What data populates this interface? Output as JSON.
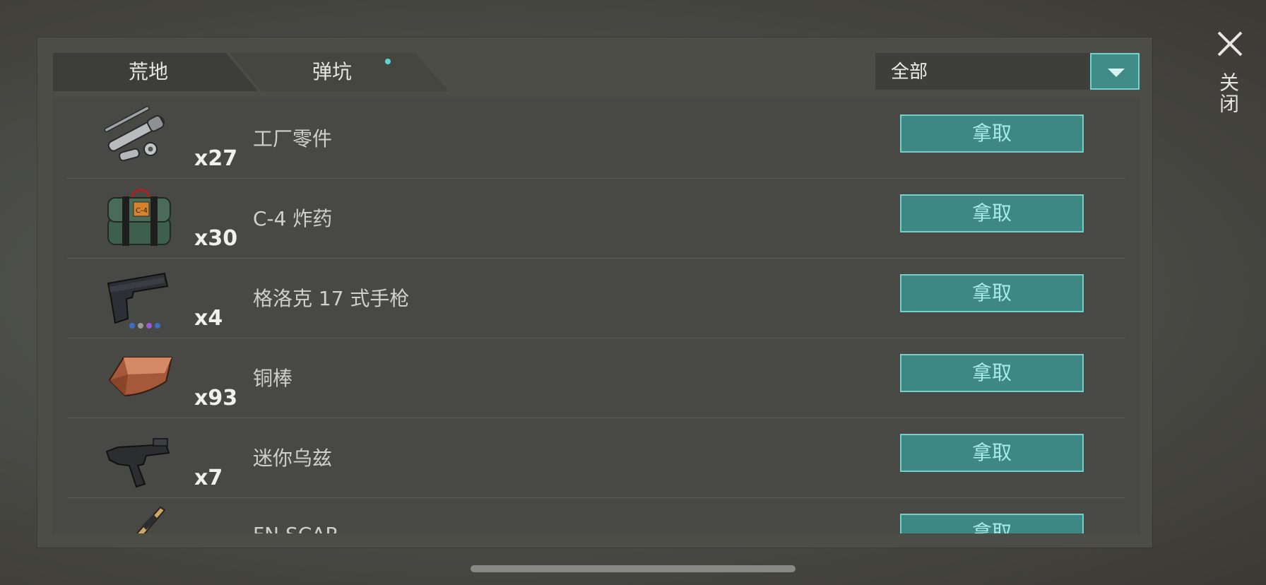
{
  "tabs": [
    {
      "label": "荒地"
    },
    {
      "label": "弹坑"
    }
  ],
  "filter": {
    "value": "全部"
  },
  "close_label": "关闭",
  "take_label": "拿取",
  "items": [
    {
      "name": "工厂零件",
      "qty": "x27",
      "icon": "factory-parts-icon"
    },
    {
      "name": "C-4 炸药",
      "qty": "x30",
      "icon": "c4-explosive-icon"
    },
    {
      "name": "格洛克 17 式手枪",
      "qty": "x4",
      "icon": "glock-pistol-icon"
    },
    {
      "name": "铜棒",
      "qty": "x93",
      "icon": "copper-bar-icon"
    },
    {
      "name": "迷你乌兹",
      "qty": "x7",
      "icon": "mini-uzi-icon"
    },
    {
      "name": "FN SCAR",
      "qty": "",
      "icon": "rifle-icon"
    }
  ],
  "colors": {
    "accent": "#3f8783",
    "accent_border": "#73cfca",
    "button_text": "#a8ecea",
    "tab_dot": "#5fd6d6"
  }
}
